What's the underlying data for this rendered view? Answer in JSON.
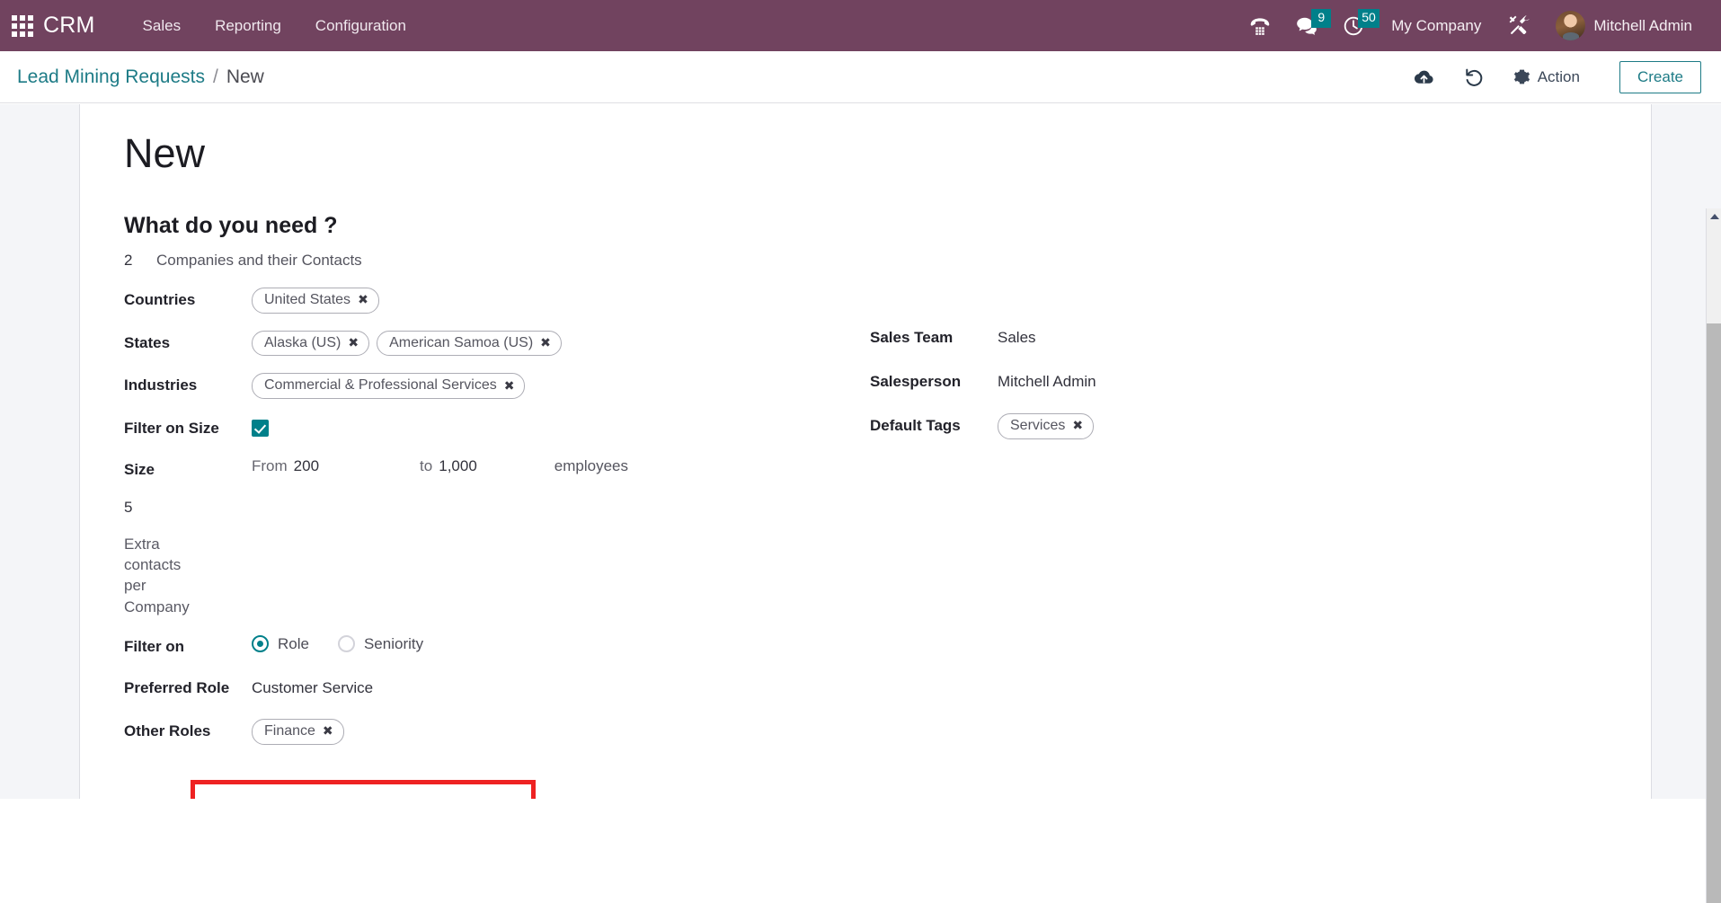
{
  "navbar": {
    "apps_icon": "apps-grid-icon",
    "brand": "CRM",
    "menu": [
      {
        "label": "Sales"
      },
      {
        "label": "Reporting"
      },
      {
        "label": "Configuration"
      }
    ],
    "systray": {
      "phone_icon": "phone-dialpad-icon",
      "messages_icon": "chat-bubble-icon",
      "messages_badge": "9",
      "activities_icon": "clock-icon",
      "activities_badge": "50",
      "company": "My Company",
      "settings_icon": "tools-icon",
      "avatar_icon": "user-avatar",
      "user": "Mitchell Admin"
    },
    "accent_color": "#71435f",
    "badge_color": "#00808a"
  },
  "control_bar": {
    "breadcrumb_root": "Lead Mining Requests",
    "breadcrumb_sep": "/",
    "breadcrumb_current": "New",
    "save_icon": "cloud-upload-icon",
    "discard_icon": "undo-icon",
    "action_icon": "gear-icon",
    "action_label": "Action",
    "create_label": "Create",
    "link_color": "#1d7b86"
  },
  "form": {
    "record_title": "New",
    "section_title": "What do you need ?",
    "lead_count": "2",
    "lead_count_label": "Companies and their Contacts",
    "left": {
      "countries_label": "Countries",
      "countries_tags": [
        "United States"
      ],
      "states_label": "States",
      "states_tags": [
        "Alaska (US)",
        "American Samoa (US)"
      ],
      "industries_label": "Industries",
      "industries_tags": [
        "Commercial & Professional Services"
      ],
      "filter_on_size_label": "Filter on Size",
      "filter_on_size_checked": true,
      "size_label": "Size",
      "size_from_label": "From",
      "size_from_value": "200",
      "size_to_label": "to",
      "size_to_value": "1,000",
      "size_unit": "employees",
      "extra_contacts_value": "5",
      "extra_contacts_label": "Extra contacts per Company",
      "filter_on_label": "Filter on",
      "filter_on_options": [
        "Role",
        "Seniority"
      ],
      "filter_on_selected": "Role",
      "preferred_role_label": "Preferred Role",
      "preferred_role_value": "Customer Service",
      "other_roles_label": "Other Roles",
      "other_roles_tags": [
        "Finance"
      ]
    },
    "right": {
      "sales_team_label": "Sales Team",
      "sales_team_value": "Sales",
      "salesperson_label": "Salesperson",
      "salesperson_value": "Mitchell Admin",
      "default_tags_label": "Default Tags",
      "default_tags": [
        "Services"
      ]
    }
  },
  "annotation": {
    "highlight_color": "#ee2222",
    "name": "preferred-role-highlight"
  },
  "tag_remove_glyph": "✖"
}
